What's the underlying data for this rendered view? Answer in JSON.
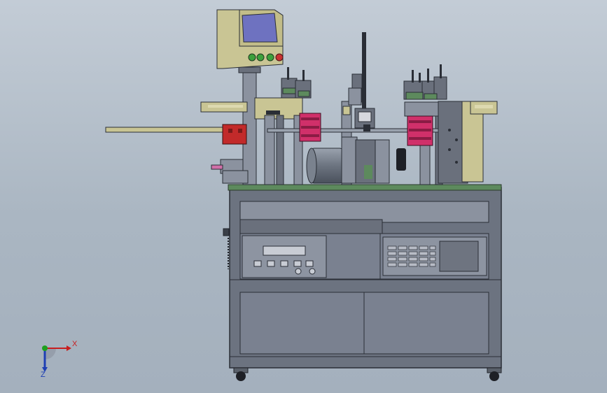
{
  "view": {
    "triad": {
      "x_label": "X",
      "z_label": "Z",
      "x_color": "#c81e1e",
      "y_color": "#1ea01e",
      "z_color": "#1e3fb4"
    }
  },
  "colors": {
    "background_top": "#c3ccd6",
    "background_bottom": "#a4b0bd",
    "cabinet": "#6c7380",
    "cabinet_panel": "#7a8190",
    "plate": "#5d8a5d",
    "enclosure": "#c9c594",
    "screen": "#6e72c0",
    "cylinder": "#d0306a",
    "slide_red": "#c22a2a",
    "button_green": "#3ca03c",
    "button_red": "#c83232"
  },
  "icons": {
    "triad": "coordinate-triad-icon"
  }
}
